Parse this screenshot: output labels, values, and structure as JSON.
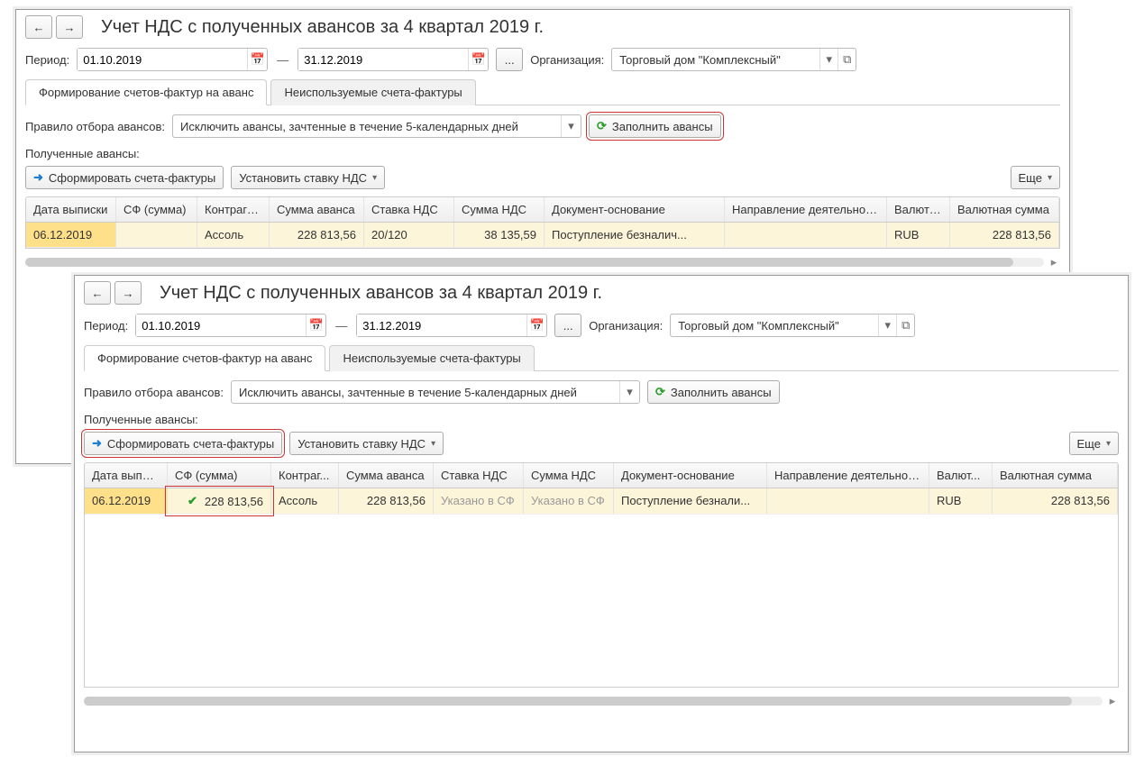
{
  "title": "Учет НДС с полученных авансов за 4 квартал 2019 г.",
  "labels": {
    "period": "Период:",
    "org": "Организация:",
    "rule": "Правило отбора авансов:",
    "received": "Полученные авансы:",
    "dots": "..."
  },
  "period": {
    "from": "01.10.2019",
    "to": "31.12.2019",
    "dash": "—"
  },
  "org": {
    "value": "Торговый дом \"Комплексный\""
  },
  "tabs": {
    "form": "Формирование счетов-фактур на аванс",
    "unused": "Неиспользуемые счета-фактуры"
  },
  "rule": {
    "value": "Исключить авансы, зачтенные в течение 5-календарных дней"
  },
  "buttons": {
    "fill": "Заполнить авансы",
    "gensf": "Сформировать счета-фактуры",
    "setvat": "Установить ставку НДС",
    "more": "Еще"
  },
  "table1": {
    "headers": {
      "date": "Дата выписки",
      "sf": "СФ (сумма)",
      "contragent": "Контрагент",
      "sum": "Сумма аванса",
      "vatrate": "Ставка НДС",
      "vatsum": "Сумма НДС",
      "docbase": "Документ-основание",
      "activity": "Направление деятельности",
      "currency": "Валюта...",
      "cursum": "Валютная сумма"
    },
    "row": {
      "date": "06.12.2019",
      "sf": "",
      "contragent": "Ассоль",
      "sum": "228 813,56",
      "vatrate": "20/120",
      "vatsum": "38 135,59",
      "docbase": "Поступление безналич...",
      "activity": "",
      "currency": "RUB",
      "cursum": "228 813,56"
    }
  },
  "table2": {
    "headers": {
      "date": "Дата выписки",
      "sf": "СФ (сумма)",
      "contragent": "Контраг...",
      "sum": "Сумма аванса",
      "vatrate": "Ставка НДС",
      "vatsum": "Сумма НДС",
      "docbase": "Документ-основание",
      "activity": "Направление деятельности",
      "currency": "Валют...",
      "cursum": "Валютная сумма"
    },
    "row": {
      "date": "06.12.2019",
      "sfsum": "228 813,56",
      "contragent": "Ассоль",
      "sum": "228 813,56",
      "vatrate": "Указано в СФ",
      "vatsum": "Указано в СФ",
      "docbase": "Поступление безнали...",
      "activity": "",
      "currency": "RUB",
      "cursum": "228 813,56"
    }
  }
}
